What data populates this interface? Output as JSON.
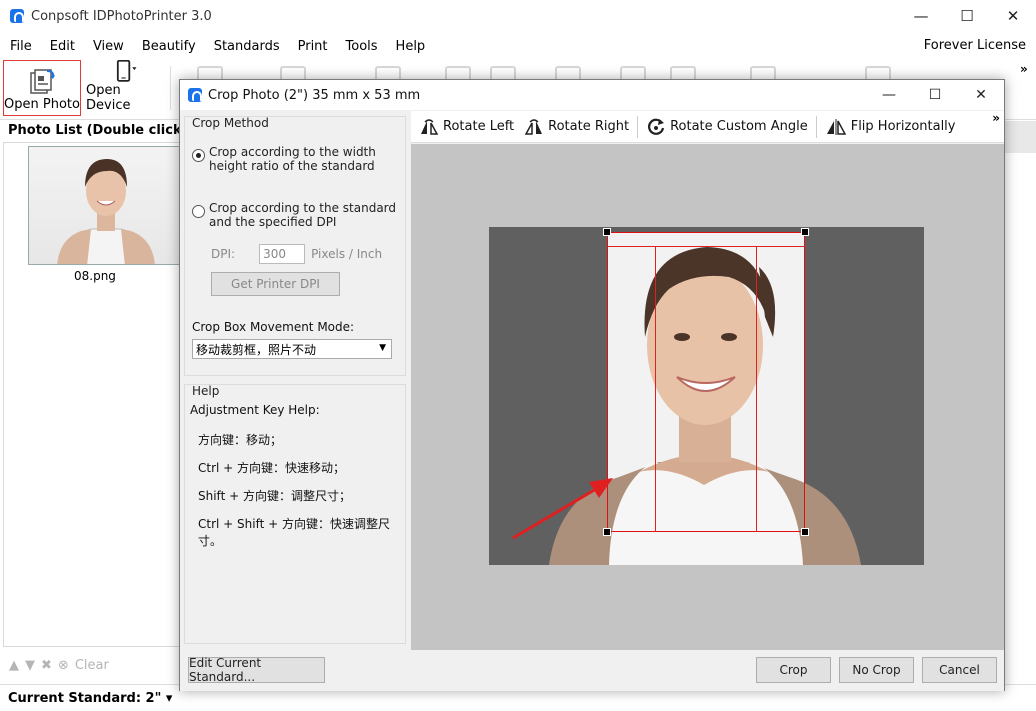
{
  "app": {
    "title": "Conpsoft IDPhotoPrinter 3.0",
    "menu": [
      "File",
      "Edit",
      "View",
      "Beautify",
      "Standards",
      "Print",
      "Tools",
      "Help"
    ],
    "license": "Forever License",
    "window_controls": {
      "minimize": "—",
      "maximize": "☐",
      "close": "✕"
    }
  },
  "toolbar": {
    "open_photo": "Open Photo",
    "open_device": "Open Device",
    "overflow": "»"
  },
  "photo_list": {
    "header": "Photo List (Double click to",
    "items": [
      {
        "name": "08.png"
      }
    ],
    "clear_label": "Clear"
  },
  "status": {
    "current_standard": "Current Standard: 2\" ▾"
  },
  "dialog": {
    "title": "Crop Photo (2\") 35 mm x 53 mm",
    "crop_method_label": "Crop Method",
    "option1_line1": "Crop according to the width",
    "option1_line2": "height ratio of the standard",
    "option2_line1": "Crop according to the standard",
    "option2_line2": "and the specified DPI",
    "dpi_label": "DPI:",
    "dpi_value": "300",
    "dpi_unit": "Pixels / Inch",
    "get_printer_dpi": "Get Printer DPI",
    "movement_label": "Crop Box Movement Mode:",
    "movement_value": "移动裁剪框，照片不动",
    "help_label": "Help",
    "adjust_help": "Adjustment Key Help:",
    "help_lines": [
      "方向键：移动；",
      "Ctrl + 方向键：快速移动；",
      "Shift + 方向键：调整尺寸；",
      "Ctrl + Shift + 方向键：快速调整尺寸。"
    ],
    "tools": {
      "rotate_left": "Rotate Left",
      "rotate_right": "Rotate Right",
      "rotate_custom": "Rotate Custom Angle",
      "flip_horizontal": "Flip Horizontally",
      "overflow": "»"
    },
    "buttons": {
      "edit_standard": "Edit Current Standard...",
      "crop": "Crop",
      "no_crop": "No Crop",
      "cancel": "Cancel"
    },
    "selected_option": "width-height-ratio",
    "accent_color": "#e02020"
  }
}
